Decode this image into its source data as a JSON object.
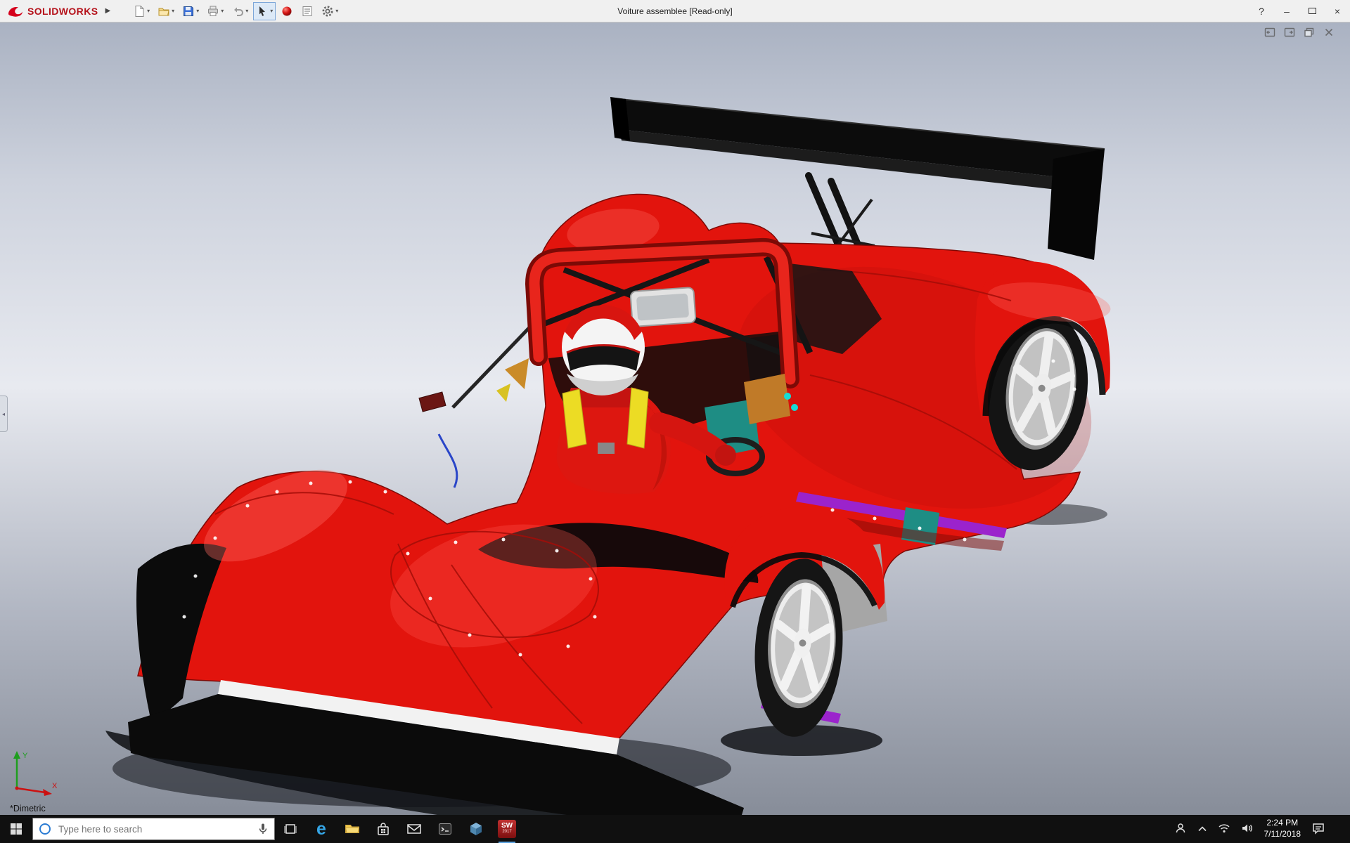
{
  "titlebar": {
    "brand": "SOLIDWORKS",
    "menu_expander": "▶",
    "title": "Voiture assemblee [Read-only]",
    "help_label": "?",
    "caret": "▾",
    "window_controls": {
      "minimize": "–",
      "close": "×"
    },
    "tools": [
      "new-document",
      "open",
      "save",
      "print",
      "undo",
      "select",
      "material-sphere",
      "sheet-format",
      "options"
    ]
  },
  "document_controls": [
    "dock-pane-left",
    "dock-pane-right",
    "restore-document",
    "close-document"
  ],
  "viewport": {
    "view_label": "*Dimetric",
    "handle_glyph": "◂",
    "triad": {
      "x": "X",
      "y": "Y"
    }
  },
  "taskbar": {
    "search_placeholder": "Type here to search",
    "edge_glyph": "e",
    "solidworks_badge": {
      "line1": "SW",
      "line2": "2017"
    },
    "apps": [
      "start",
      "cortana-search",
      "task-view",
      "edge",
      "file-explorer",
      "store",
      "mail",
      "console",
      "app-cube",
      "solidworks-2017"
    ],
    "tray": [
      "people",
      "hidden-icons",
      "network",
      "volume",
      "clock",
      "notifications"
    ],
    "clock": {
      "time": "2:24 PM",
      "date": "7/11/2018"
    }
  },
  "colors": {
    "titlebar_bg": "#f0f0f0",
    "taskbar_bg": "#101010",
    "bg_top": "#aab2c2",
    "bg_mid": "#e8eaf0",
    "bg_bottom": "#878d99",
    "car_red": "#e2140d",
    "car_red_dark": "#a30d08",
    "car_red_light": "#ff6a60",
    "wing_black": "#0c0c0c",
    "accent_purple": "#9b23cc",
    "accent_teal": "#1e8d84",
    "accent_orange": "#c07a28",
    "rim_white": "#ededed"
  }
}
